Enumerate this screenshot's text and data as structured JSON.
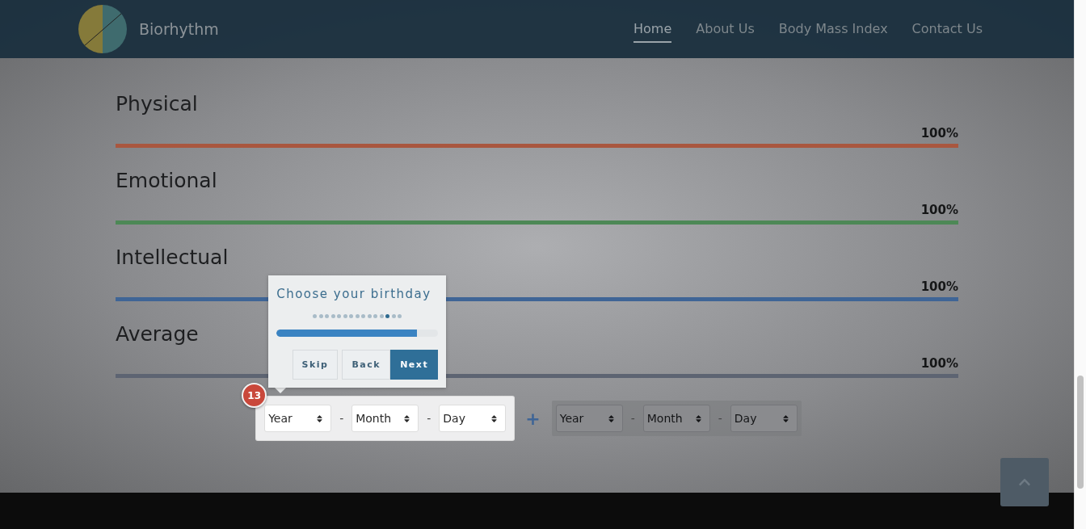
{
  "brand": {
    "name": "Biorhythm"
  },
  "nav": [
    {
      "label": "Home",
      "selected": true
    },
    {
      "label": "About Us",
      "selected": false
    },
    {
      "label": "Body Mass Index",
      "selected": false
    },
    {
      "label": "Contact Us",
      "selected": false
    }
  ],
  "metrics": [
    {
      "name": "Physical",
      "reading": "100%",
      "color": "#a9573f"
    },
    {
      "name": "Emotional",
      "reading": "100%",
      "color": "#4d8856"
    },
    {
      "name": "Intellectual",
      "reading": "100%",
      "color": "#3f6596"
    },
    {
      "name": "Average",
      "reading": "100%",
      "color": "#5d6472"
    }
  ],
  "birthday_forms": [
    {
      "highlighted": true,
      "fields": [
        {
          "value": "Year"
        },
        {
          "value": "Month"
        },
        {
          "value": "Day"
        }
      ],
      "separators": [
        "-",
        "-"
      ]
    },
    {
      "highlighted": false,
      "fields": [
        {
          "value": "Year"
        },
        {
          "value": "Month"
        },
        {
          "value": "Day"
        }
      ],
      "separators": [
        "-",
        "-"
      ]
    }
  ],
  "joiner": "+",
  "tour": {
    "title": "Choose your birthday",
    "badge": "13",
    "level": 0.87,
    "steps": [
      {
        "selected": false
      },
      {
        "selected": false
      },
      {
        "selected": false
      },
      {
        "selected": false
      },
      {
        "selected": false
      },
      {
        "selected": false
      },
      {
        "selected": false
      },
      {
        "selected": false
      },
      {
        "selected": false
      },
      {
        "selected": false
      },
      {
        "selected": false
      },
      {
        "selected": false
      },
      {
        "selected": true
      },
      {
        "selected": false
      },
      {
        "selected": false
      }
    ],
    "buttons": [
      {
        "label": "Skip",
        "kind": "plain"
      },
      {
        "label": "Back",
        "kind": "plain"
      },
      {
        "label": "Next",
        "kind": "primary"
      }
    ]
  }
}
